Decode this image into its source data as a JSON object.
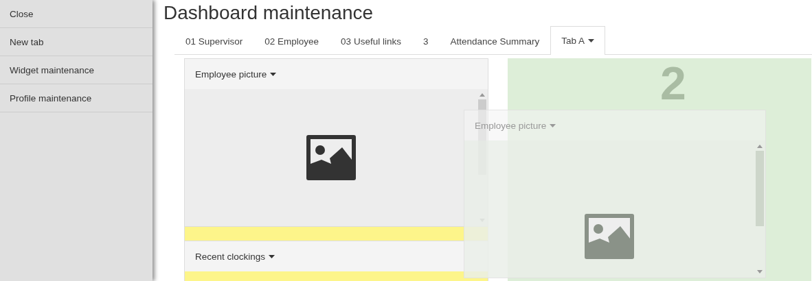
{
  "sidebar": {
    "items": [
      {
        "label": "Close"
      },
      {
        "label": "New tab"
      },
      {
        "label": "Widget maintenance"
      },
      {
        "label": "Profile maintenance"
      }
    ]
  },
  "title": "Dashboard maintenance",
  "tabs": [
    {
      "label": "01 Supervisor",
      "selected": false,
      "kind": "plain"
    },
    {
      "label": "02 Employee",
      "selected": false,
      "kind": "plain"
    },
    {
      "label": "03 Useful links",
      "selected": false,
      "kind": "plain"
    },
    {
      "label": "3",
      "selected": false,
      "kind": "plain"
    },
    {
      "label": "Attendance Summary",
      "selected": false,
      "kind": "plain"
    },
    {
      "label": "Tab A",
      "selected": true,
      "kind": "dropdown"
    }
  ],
  "widgets": [
    {
      "title": "Employee picture",
      "kind": "picture"
    },
    {
      "title": "Recent clockings",
      "kind": "empty"
    }
  ],
  "drop_zone": {
    "label": "2"
  },
  "dragged_widget": {
    "title": "Employee picture"
  }
}
